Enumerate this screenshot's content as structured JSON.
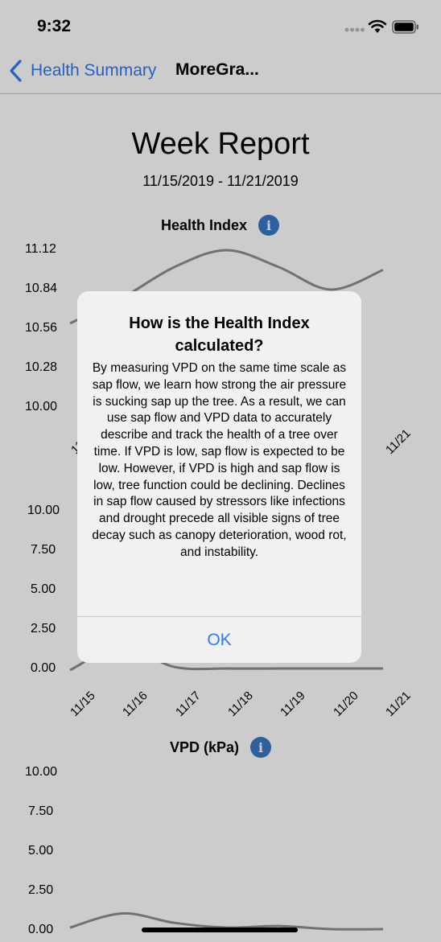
{
  "status_bar": {
    "time": "9:32"
  },
  "nav": {
    "back_label": "Health Summary",
    "title": "MoreGra..."
  },
  "report": {
    "title": "Week Report",
    "date_range": "11/15/2019 - 11/21/2019"
  },
  "chart_data": [
    {
      "type": "line",
      "title": "Health Index",
      "y_ticks": [
        "11.12",
        "10.84",
        "10.56",
        "10.28",
        "10.00"
      ],
      "x_ticks": [
        "11/15",
        "11/16",
        "11/17",
        "11/18",
        "11/19",
        "11/20",
        "11/21"
      ],
      "x": [
        "11/15",
        "11/16",
        "11/17",
        "11/18",
        "11/19",
        "11/20",
        "11/21"
      ],
      "series": [
        {
          "values": [
            10.6,
            10.78,
            11.0,
            11.12,
            11.0,
            10.84,
            10.98
          ]
        }
      ],
      "ylim": [
        10.0,
        11.12
      ],
      "line_color": "#8e8e8e"
    },
    {
      "type": "line",
      "title": "",
      "y_ticks": [
        "10.00",
        "7.50",
        "5.00",
        "2.50",
        "0.00"
      ],
      "x_ticks": [
        "11/15",
        "11/16",
        "11/17",
        "11/18",
        "11/19",
        "11/20",
        "11/21"
      ],
      "x": [
        "11/15",
        "11/16",
        "11/17",
        "11/18",
        "11/19",
        "11/20",
        "11/21"
      ],
      "series": [
        {
          "values": [
            0.0,
            1.5,
            0.2,
            0.1,
            0.1,
            0.1,
            0.1
          ]
        }
      ],
      "ylim": [
        0,
        10
      ],
      "line_color": "#8e8e8e"
    },
    {
      "type": "line",
      "title": "VPD (kPa)",
      "y_ticks": [
        "10.00",
        "7.50",
        "5.00",
        "2.50",
        "0.00"
      ],
      "x": [
        "11/15",
        "11/16",
        "11/17",
        "11/18",
        "11/19",
        "11/20",
        "11/21"
      ],
      "series": [
        {
          "values": [
            0.2,
            1.1,
            0.5,
            0.2,
            0.3,
            0.1,
            0.1
          ]
        }
      ],
      "ylim": [
        0,
        10
      ],
      "line_color": "#8e8e8e"
    }
  ],
  "alert": {
    "title": "How is the Health Index calculated?",
    "message": "By measuring VPD on the same time scale as sap flow, we learn how strong the air pressure is sucking sap up the tree. As a result, we can use sap flow and VPD data to accurately describe and track the health of a tree over time. If VPD is low, sap flow is expected to be low. However, if VPD is high and sap flow is low, tree function could be declining. Declines in sap flow caused by stressors like infections and drought precede all visible signs of tree decay such as canopy deterioration, wood rot, and instability.",
    "ok_label": "OK"
  },
  "icons": {
    "back": "chevron-left-icon",
    "info": "info-icon",
    "wifi": "wifi-icon",
    "battery": "battery-icon",
    "signal": "signal-icon"
  },
  "colors": {
    "accent": "#3478f6",
    "info": "#3a78c6"
  }
}
